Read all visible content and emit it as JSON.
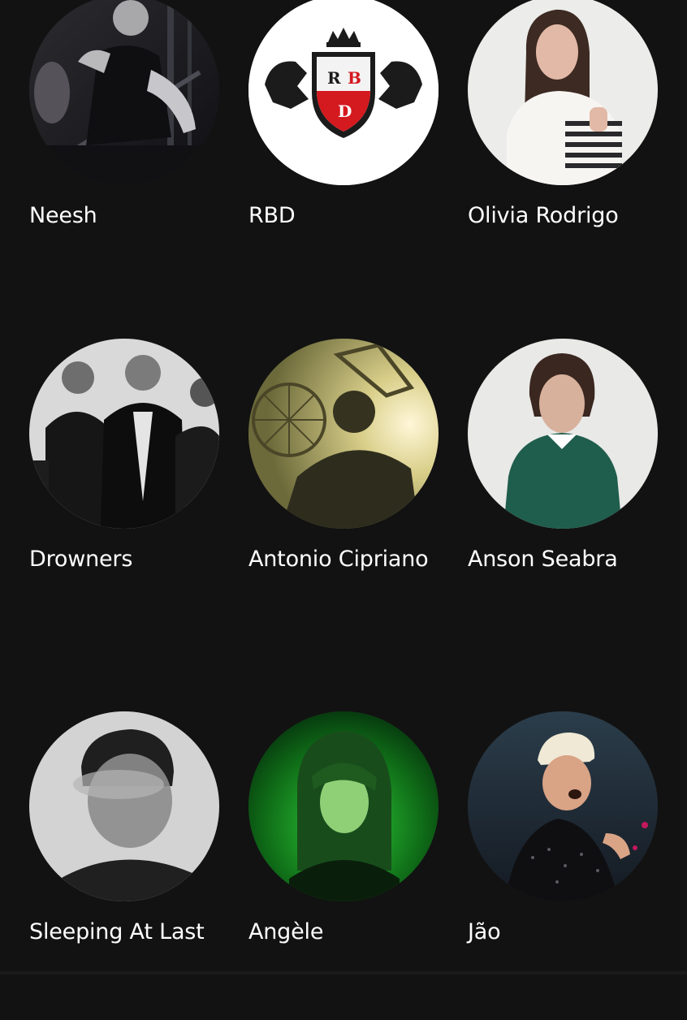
{
  "artists": [
    {
      "name": "Neesh",
      "image": "dark-concert-photo"
    },
    {
      "name": "RBD",
      "image": "rbd-crest-logo"
    },
    {
      "name": "Olivia Rodrigo",
      "image": "portrait-striped-sweater"
    },
    {
      "name": "Drowners",
      "image": "black-white-band-photo"
    },
    {
      "name": "Antonio Cipriano",
      "image": "ferris-wheel-sunset-photo"
    },
    {
      "name": "Anson Seabra",
      "image": "portrait-green-sweater"
    },
    {
      "name": "Sleeping At Last",
      "image": "blurred-monochrome-portrait"
    },
    {
      "name": "Angèle",
      "image": "green-lit-portrait"
    },
    {
      "name": "Jão",
      "image": "stage-performance-photo"
    }
  ],
  "logo_text": {
    "r": "R",
    "b": "B",
    "d": "D"
  },
  "colors": {
    "background": "#121212",
    "text": "#ffffff",
    "rbd_red": "#d4191f",
    "angele_green": "#2fd33a"
  }
}
